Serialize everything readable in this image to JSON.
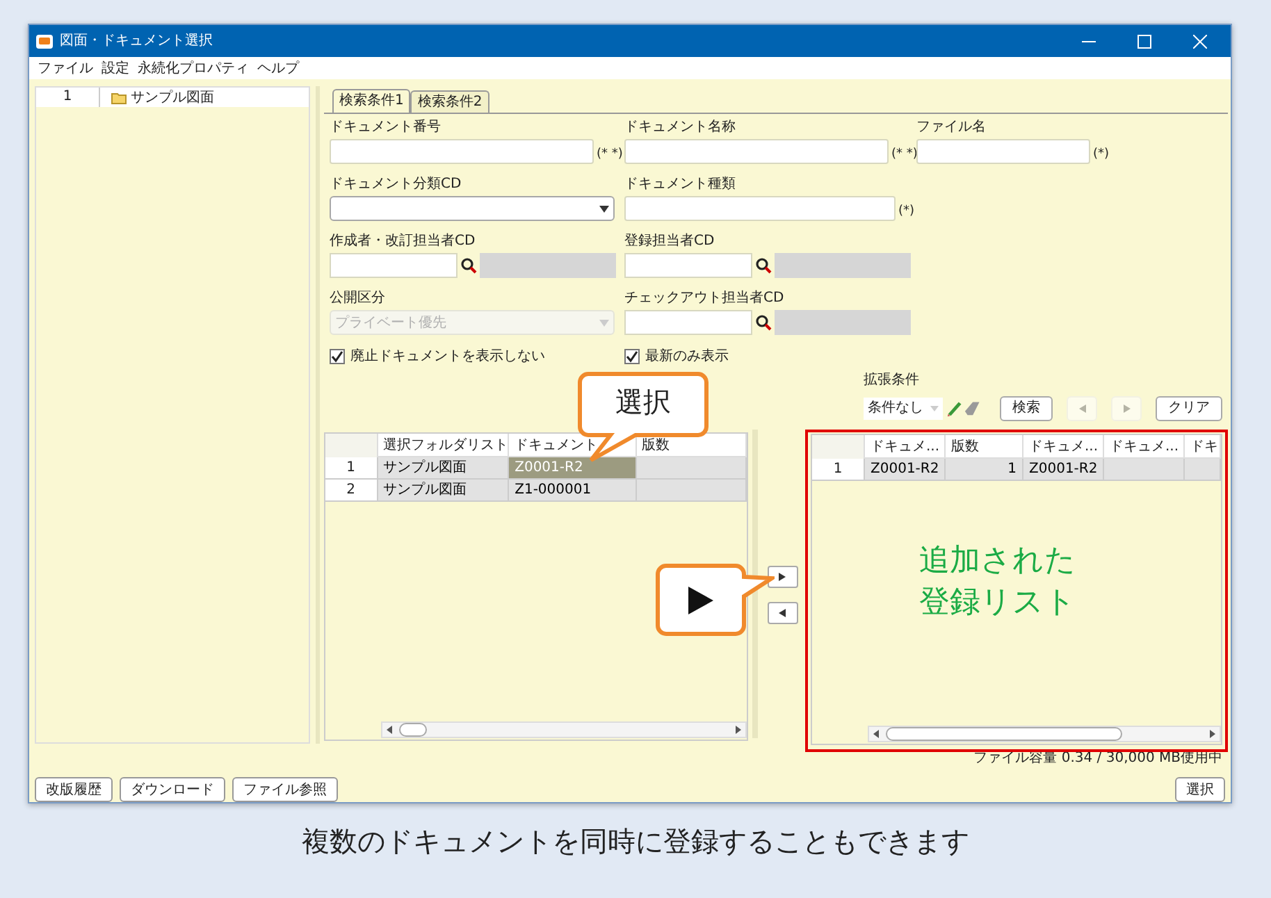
{
  "window": {
    "title": "図面・ドキュメント選択"
  },
  "menu": [
    "ファイル",
    "設定",
    "永続化プロパティ",
    "ヘルプ"
  ],
  "tree": {
    "rows": [
      {
        "number": "1",
        "label": "サンプル図面"
      }
    ]
  },
  "tabs": [
    {
      "label": "検索条件1",
      "selected": true
    },
    {
      "label": "検索条件2",
      "selected": false
    }
  ],
  "form_rows": [
    [
      {
        "kind": "text",
        "label": "ドキュメント番号",
        "note": "(* *)"
      },
      {
        "kind": "text",
        "label": "ドキュメント名称",
        "note": "(* *)"
      },
      {
        "kind": "text",
        "label": "ファイル名",
        "note": "(*)"
      }
    ],
    [
      {
        "kind": "select",
        "label": "ドキュメント分類CD",
        "disabled": false
      },
      {
        "kind": "text",
        "label": "ドキュメント種類",
        "note": "(*)"
      }
    ],
    [
      {
        "kind": "lookup",
        "label": "作成者・改訂担当者CD"
      },
      {
        "kind": "lookup",
        "label": "登録担当者CD"
      }
    ],
    [
      {
        "kind": "select",
        "label": "公開区分",
        "value": "プライベート優先",
        "disabled": true
      },
      {
        "kind": "lookup",
        "label": "チェックアウト担当者CD"
      }
    ],
    [
      {
        "kind": "checkbox",
        "label": "廃止ドキュメントを表示しない",
        "checked": true
      },
      {
        "kind": "checkbox",
        "label": "最新のみ表示",
        "checked": true
      }
    ]
  ],
  "extended": {
    "label": "拡張条件",
    "select_value": "条件なし",
    "buttons": [
      {
        "kind": "text",
        "label": "検索",
        "disabled": false
      },
      {
        "kind": "prev",
        "disabled": true
      },
      {
        "kind": "next",
        "disabled": true
      },
      {
        "kind": "text",
        "label": "クリア",
        "disabled": false
      }
    ]
  },
  "left_table": {
    "columns": [
      "選択フォルダリスト",
      "ドキュメント",
      "版数"
    ],
    "rows": [
      {
        "number": "1",
        "cells": [
          "サンプル図面",
          "Z0001-R2"
        ],
        "selected": true
      },
      {
        "number": "2",
        "cells": [
          "サンプル図面",
          "Z1-000001"
        ],
        "selected": false
      }
    ]
  },
  "transfer_buttons": [
    {
      "kind": "add"
    },
    {
      "kind": "remove"
    }
  ],
  "right_table": {
    "columns": [
      "ドキュメ...",
      "版数",
      "ドキュメ...",
      "ドキュメ...",
      "ドキ"
    ],
    "rows": [
      {
        "number": "1",
        "cells": [
          "Z0001-R2",
          "1",
          "Z0001-R2"
        ],
        "selected": false
      }
    ]
  },
  "right_note": [
    "追加された",
    "登録リスト"
  ],
  "status": "ファイル容量 0.34 / 30,000 MB使用中",
  "bottom_buttons": [
    "改版履歴",
    "ダウンロード",
    "ファイル参照"
  ],
  "select_button": "選択",
  "callouts": [
    {
      "kind": "text",
      "label": "選択"
    },
    {
      "kind": "play"
    }
  ],
  "caption": "複数のドキュメントを同時に登録することもできます"
}
